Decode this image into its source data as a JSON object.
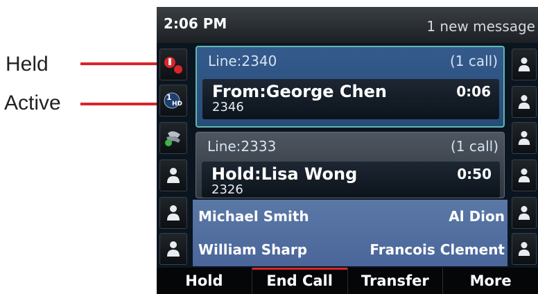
{
  "callouts": {
    "held_label": "Held",
    "active_label": "Active"
  },
  "status_bar": {
    "time": "2:06 PM",
    "message": "1 new message"
  },
  "calls": [
    {
      "line": "Line:2340",
      "count": "(1 call)",
      "caller": "From:George Chen",
      "number": "2346",
      "timer": "0:06",
      "state": "active"
    },
    {
      "line": "Line:2333",
      "count": "(1 call)",
      "caller": "Hold:Lisa Wong",
      "number": "2326",
      "timer": "0:50",
      "state": "held"
    }
  ],
  "contacts": {
    "row1_left": "Michael Smith",
    "row1_right": "Al Dion",
    "row2_left": "William Sharp",
    "row2_right": "Francois Clement"
  },
  "left_keys": [
    "held-call-icon",
    "active-call-icon",
    "line-key-icon",
    "contact-icon",
    "contact-icon",
    "contact-icon"
  ],
  "right_keys": [
    "contact-icon",
    "contact-icon",
    "contact-icon",
    "contact-icon",
    "contact-icon",
    "contact-icon"
  ],
  "softkeys": [
    "Hold",
    "End Call",
    "Transfer",
    "More"
  ],
  "colors": {
    "callout_red": "#d9252b",
    "active_border": "#5fb9b0",
    "contact_blue": "#5a78a6"
  }
}
